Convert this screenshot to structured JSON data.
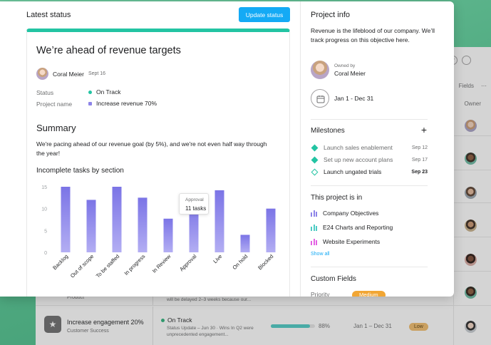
{
  "background": {
    "fields_label": "Fields",
    "owner_header": "Owner",
    "top_icon_help": "?",
    "rows": [
      {
        "sub": "Product",
        "update": "will be delayed 2–3 weeks because our..."
      },
      {
        "title": "Increase engagement 20%",
        "sub": "Customer Success",
        "status": "On Track",
        "update": "Status Update – Jun 30 · Wins In Q2 were unprecedented engagement...",
        "progress_value": 0.88,
        "progress_text": "88%",
        "dates": "Jan 1 – Dec 31",
        "priority": "Low"
      }
    ]
  },
  "modal": {
    "left": {
      "title": "Latest status",
      "update_button": "Update status",
      "card": {
        "headline": "We’re ahead of revenue targets",
        "author": "Coral Meier",
        "author_date": "Sept 16",
        "status_label": "Status",
        "status_value": "On Track",
        "project_label": "Project name",
        "project_value": "Increase revenue 70%",
        "summary_heading": "Summary",
        "summary_text": "We're pacing ahead of our revenue goal (by 5%), and we're not even half way through the year!",
        "chart_heading": "Incomplete tasks by section",
        "tooltip_label": "Approval",
        "tooltip_value": "11 tasks"
      }
    },
    "right": {
      "title": "Project info",
      "description": "Revenue is the lifeblood of our company. We’ll track progress on this objective here.",
      "owned_by_label": "Owned by",
      "owner_name": "Coral Meier",
      "date_range": "Jan 1 - Dec 31",
      "milestones_heading": "Milestones",
      "milestones": [
        {
          "name": "Launch sales enablement",
          "date": "Sep 12",
          "done": true
        },
        {
          "name": "Set up new account plans",
          "date": "Sep 17",
          "done": true
        },
        {
          "name": "Launch ungated trials",
          "date": "Sep 23",
          "done": false
        }
      ],
      "project_in_heading": "This project is in",
      "projects": [
        {
          "name": "Company Objectives",
          "color": "#8d84e8"
        },
        {
          "name": "E24 Charts and Reporting",
          "color": "#4ecbc4"
        },
        {
          "name": "Website Experiments",
          "color": "#e362e3"
        }
      ],
      "show_all": "Show all",
      "custom_fields_heading": "Custom Fields",
      "priority_label": "Priority",
      "priority_value": "Medium"
    }
  },
  "colors": {
    "accent_teal": "#23c4a3",
    "button_blue": "#14aaf5",
    "bar_top": "#7b74e6",
    "bar_bottom": "#b3aef3"
  },
  "chart_data": {
    "type": "bar",
    "title": "Incomplete tasks by section",
    "categories": [
      "Backlog",
      "Out of scope",
      "To be staffed",
      "In progress",
      "In Review",
      "Approval",
      "Live",
      "On hold",
      "Blocked"
    ],
    "values": [
      15,
      12,
      15,
      12.5,
      7.7,
      11,
      14.2,
      4,
      10
    ],
    "yticks": [
      0,
      5,
      10,
      15
    ],
    "ylim": [
      0,
      15
    ],
    "grid": false
  }
}
